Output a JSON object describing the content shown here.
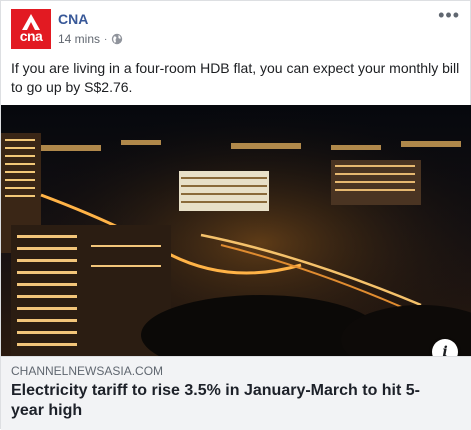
{
  "post": {
    "page_name": "CNA",
    "avatar_text": "cna",
    "timestamp": "14 mins",
    "separator": "·",
    "privacy_icon": "globe-icon",
    "more_icon": "more-options-icon",
    "more_label": "•••",
    "text": "If you are living in a four-room HDB flat, you can expect your monthly bill to go up by S$2.76."
  },
  "link_preview": {
    "domain": "CHANNELNEWSASIA.COM",
    "headline": "Electricity tariff to rise 3.5% in January-March to hit 5-year high",
    "info_label": "i"
  },
  "colors": {
    "brand": "#e21a22",
    "link": "#385898",
    "meta": "#616770",
    "preview_bg": "#f2f3f5"
  }
}
